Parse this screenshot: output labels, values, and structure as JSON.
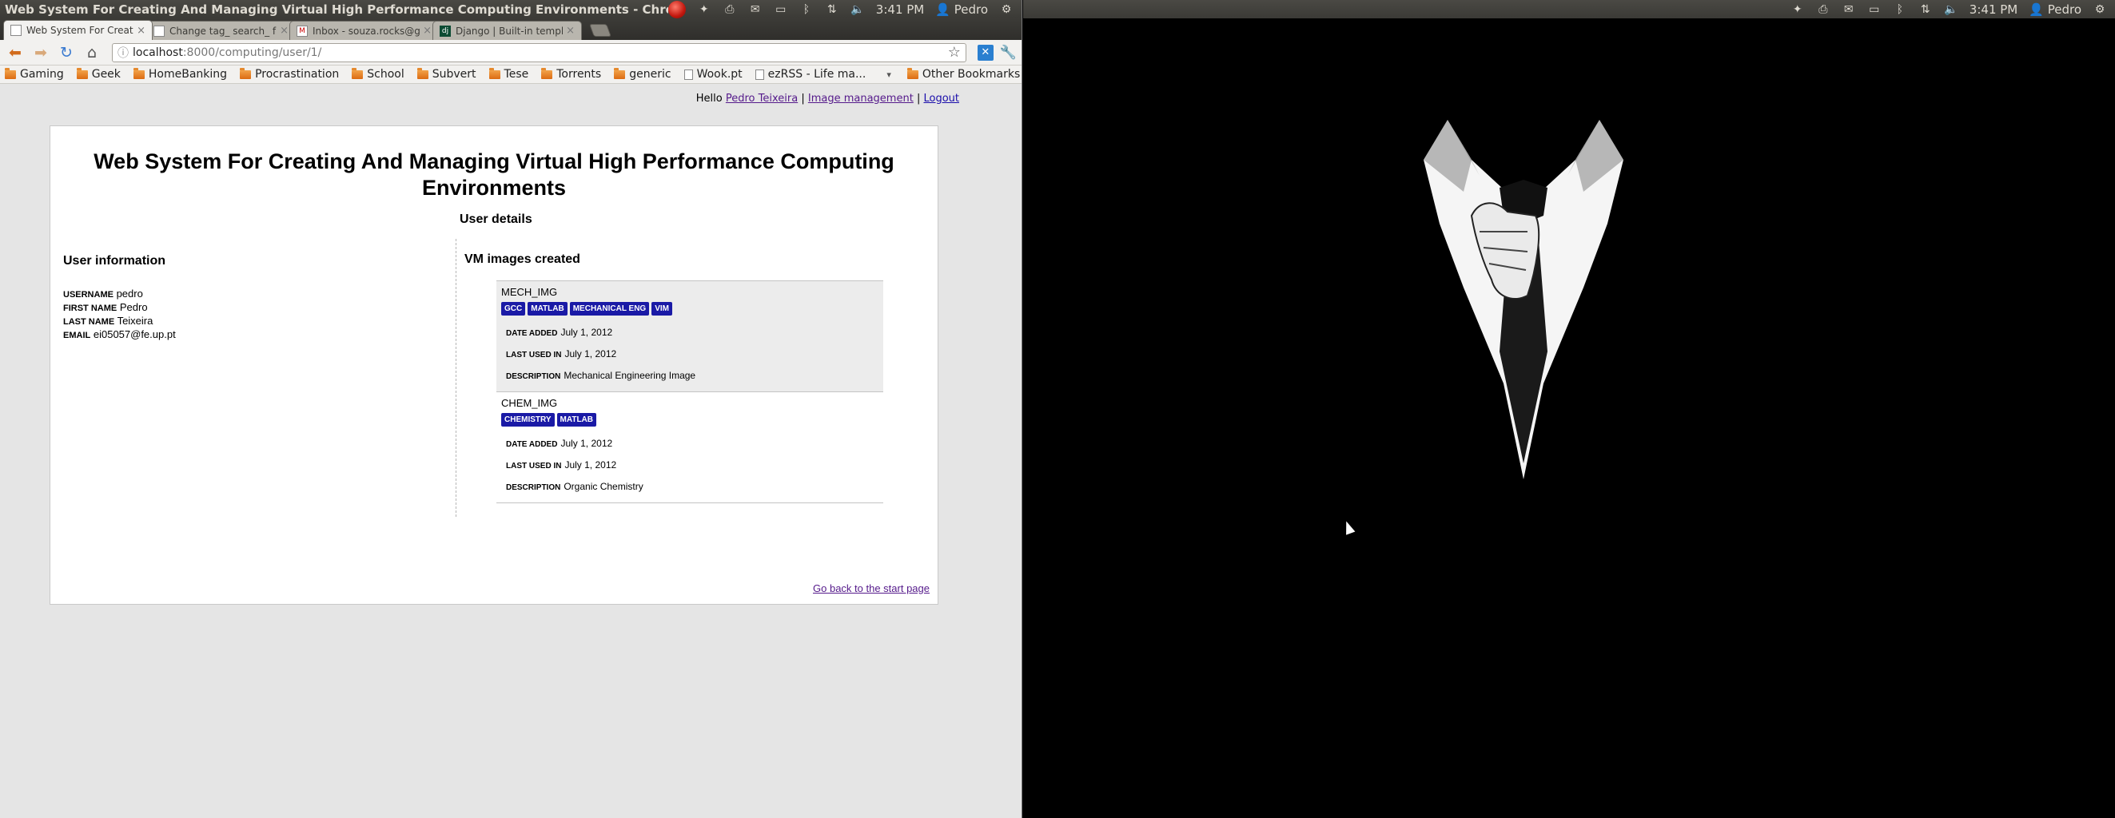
{
  "left_panel": {
    "window_title": "Web System For Creating And Managing Virtual High Performance Computing Environments - Chromium",
    "clock": "3:41 PM",
    "user": "Pedro"
  },
  "right_panel": {
    "clock": "3:41 PM",
    "user": "Pedro"
  },
  "tabs": [
    {
      "title": "Web System For Creating"
    },
    {
      "title": "Change tag_ search_ freq"
    },
    {
      "title": "Inbox - souza.rocks@gmai"
    },
    {
      "title": "Django | Built-in template"
    }
  ],
  "toolbar": {
    "url_host": "localhost",
    "url_path": ":8000/computing/user/1/"
  },
  "bookmarks": {
    "items": [
      "Gaming",
      "Geek",
      "HomeBanking",
      "Procrastination",
      "School",
      "Subvert",
      "Tese",
      "Torrents",
      "generic"
    ],
    "pages": [
      "Wook.pt",
      "ezRSS - Life ma..."
    ],
    "other": "Other Bookmarks"
  },
  "userbar": {
    "greeting": "Hello",
    "user_link": "Pedro Teixeira",
    "sep1": "|",
    "images_link": "Image management",
    "sep2": "|",
    "logout_link": "Logout"
  },
  "page": {
    "title": "Web System For Creating And Managing Virtual High Performance Computing Environments",
    "user_details_heading": "User details",
    "user_info_heading": "User information",
    "user_info": {
      "username_label": "Username",
      "username": "pedro",
      "first_name_label": "First name",
      "first_name": "Pedro",
      "last_name_label": "Last name",
      "last_name": "Teixeira",
      "email_label": "Email",
      "email": "ei05057@fe.up.pt"
    },
    "vm_heading": "VM images created",
    "vm_images": [
      {
        "name": "MECH_IMG",
        "tags": [
          "GCC",
          "MATLAB",
          "MECHANICAL ENG",
          "VIM"
        ],
        "date_added_label": "Date added",
        "date_added": "July 1, 2012",
        "last_used_label": "Last used in",
        "last_used": "July 1, 2012",
        "description_label": "Description",
        "description": "Mechanical Engineering Image"
      },
      {
        "name": "CHEM_IMG",
        "tags": [
          "CHEMISTRY",
          "MATLAB"
        ],
        "date_added_label": "Date added",
        "date_added": "July 1, 2012",
        "last_used_label": "Last used in",
        "last_used": "July 1, 2012",
        "description_label": "Description",
        "description": "Organic Chemistry"
      }
    ],
    "back_link": "Go back to the start page"
  },
  "colors": {
    "tag_bg": "#1a1aa6",
    "link_visited": "#551a8b",
    "panel_bg": "#3c3b37"
  }
}
